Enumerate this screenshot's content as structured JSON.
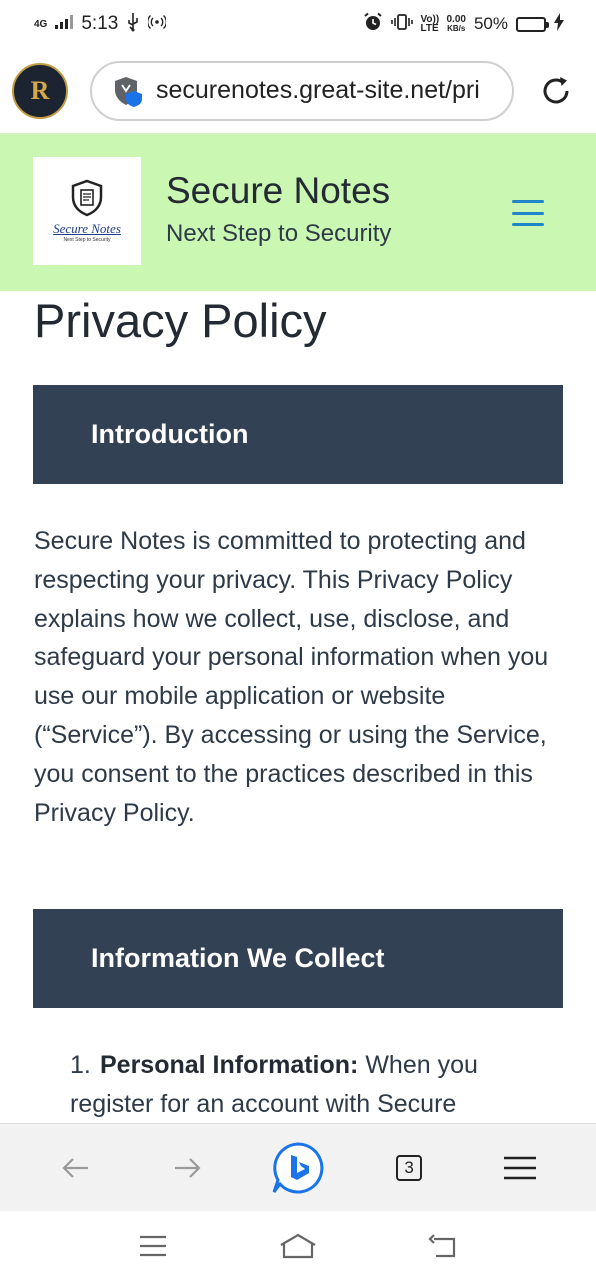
{
  "status_bar": {
    "network": "4G",
    "time": "5:13",
    "volte": "Vo)) LTE",
    "speed_value": "0.00",
    "speed_unit": "KB/s",
    "battery": "50%",
    "battery_level": 0.5
  },
  "browser": {
    "profile_initials": "R",
    "url": "securenotes.great-site.net/pri",
    "tab_count": "3"
  },
  "site": {
    "logo_name": "Secure Notes",
    "logo_tagline": "Next Step to Security",
    "title": "Secure Notes",
    "tagline": "Next Step to Security"
  },
  "page": {
    "title": "Privacy Policy",
    "section1_title": "Introduction",
    "intro_paragraph": "Secure Notes is committed to protecting and respecting your privacy. This Privacy Policy explains how we collect, use, disclose, and safeguard your personal information when you use our mobile application or website (“Service”). By accessing or using the Service, you consent to the practices described in this Privacy Policy.",
    "section2_title": "Information We Collect",
    "list": [
      {
        "number": "1.",
        "term": "Personal Information:",
        "text": " When you register for an account with Secure"
      }
    ]
  },
  "colors": {
    "header_bg": "#caf7b2",
    "section_bg": "#334155",
    "menu_accent": "#1f86c9",
    "bing_blue": "#1a73e8"
  }
}
